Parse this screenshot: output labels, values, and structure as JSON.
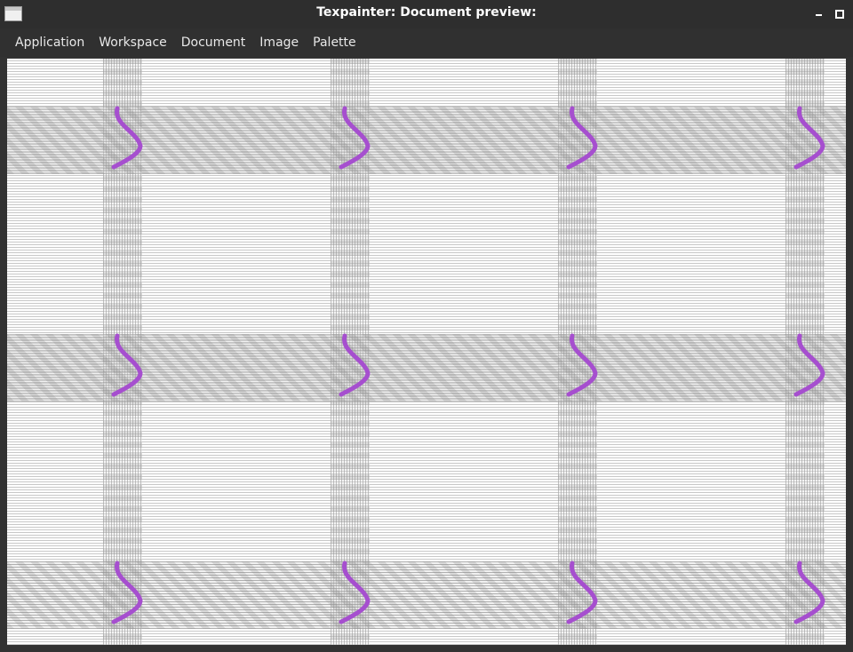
{
  "window": {
    "title": "Texpainter: Document preview:",
    "icons": {
      "app": "window-app-icon",
      "minimize": "minimize-icon",
      "maximize": "maximize-icon"
    }
  },
  "menubar": {
    "items": [
      "Application",
      "Workspace",
      "Document",
      "Image",
      "Palette"
    ]
  },
  "preview": {
    "description_icon": "tiled-texture-preview",
    "tile_columns": 4,
    "tile_rows": 3,
    "stroke_color": "#a64fcf",
    "hatch_color": "#c8c8c8",
    "background_color": "#ffffff"
  }
}
